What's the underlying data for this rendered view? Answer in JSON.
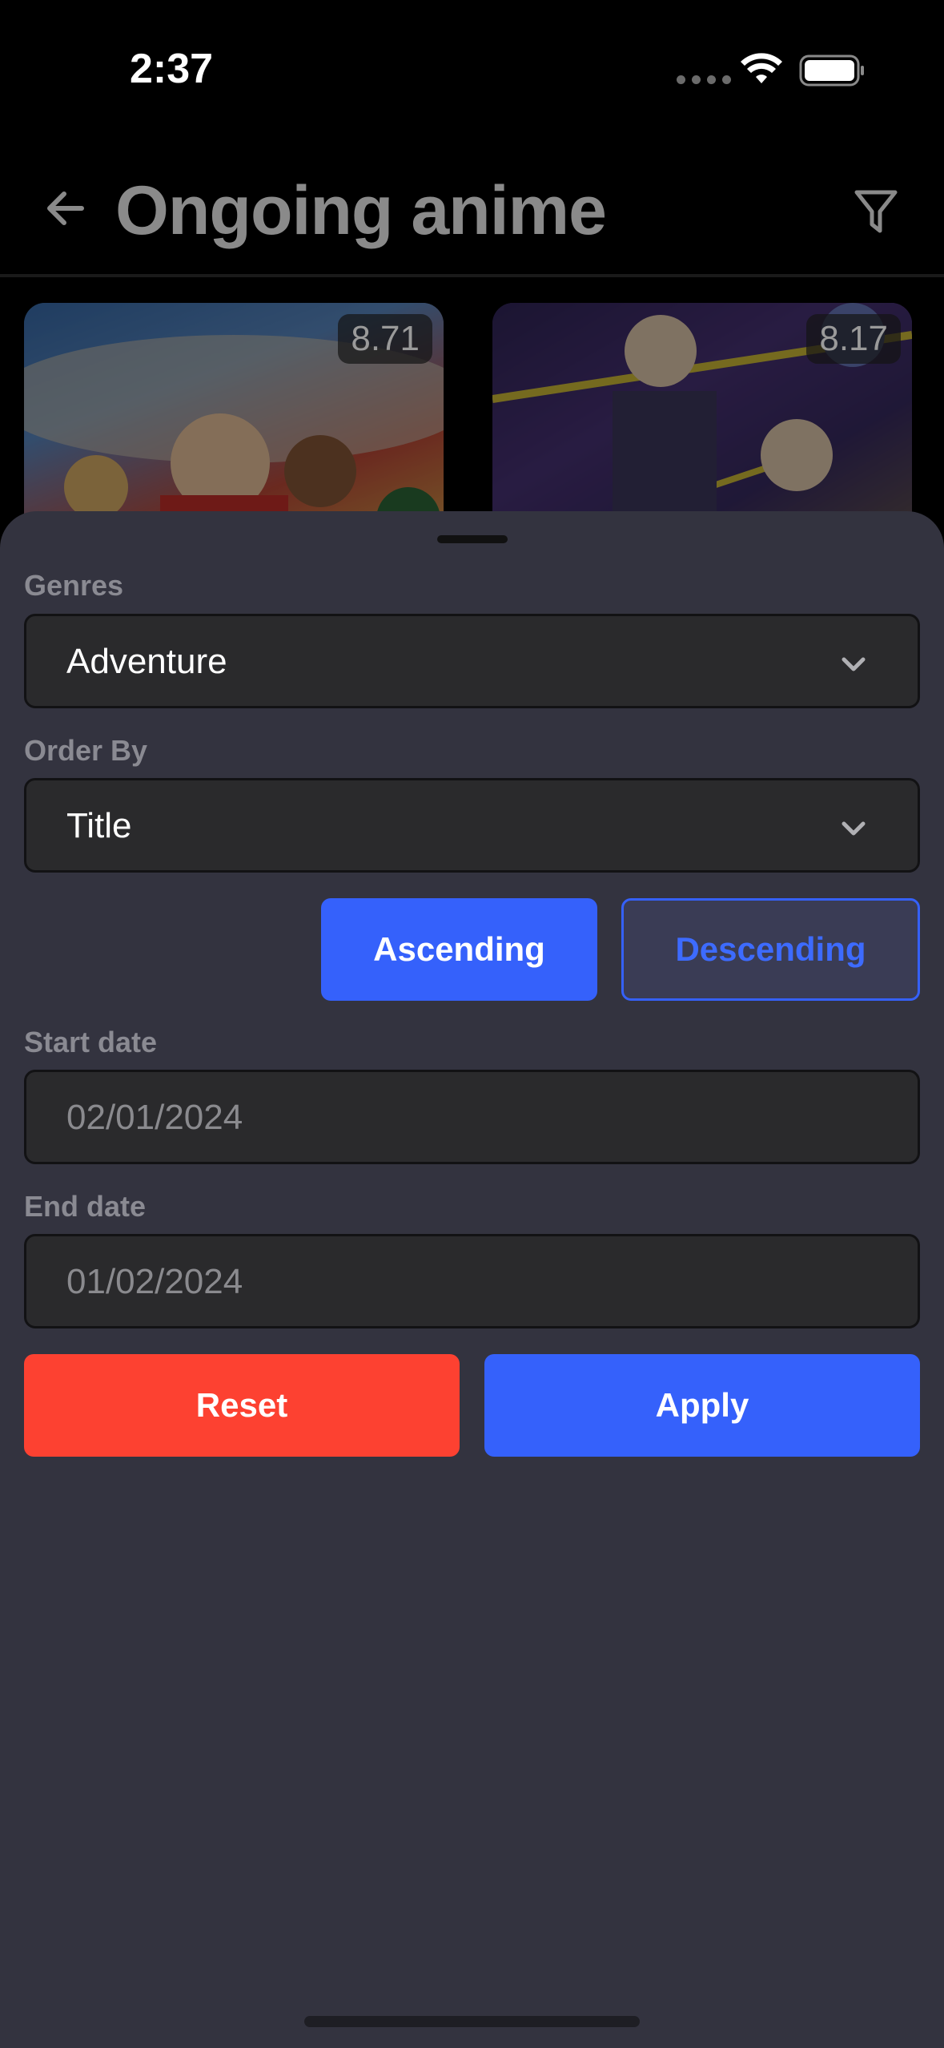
{
  "status_bar": {
    "time": "2:37"
  },
  "nav": {
    "title": "Ongoing anime"
  },
  "cards": [
    {
      "score": "8.71"
    },
    {
      "score": "8.17"
    }
  ],
  "filters": {
    "genres_label": "Genres",
    "genres_value": "Adventure",
    "order_by_label": "Order By",
    "order_by_value": "Title",
    "ascending_label": "Ascending",
    "descending_label": "Descending",
    "selected_order": "Ascending",
    "start_date_label": "Start date",
    "start_date_placeholder": "02/01/2024",
    "end_date_label": "End date",
    "end_date_placeholder": "01/02/2024",
    "reset_label": "Reset",
    "apply_label": "Apply"
  },
  "colors": {
    "accent": "#3561fb",
    "danger": "#fd4131",
    "sheet_background": "#33333f",
    "field_background": "#2a2a2c"
  }
}
